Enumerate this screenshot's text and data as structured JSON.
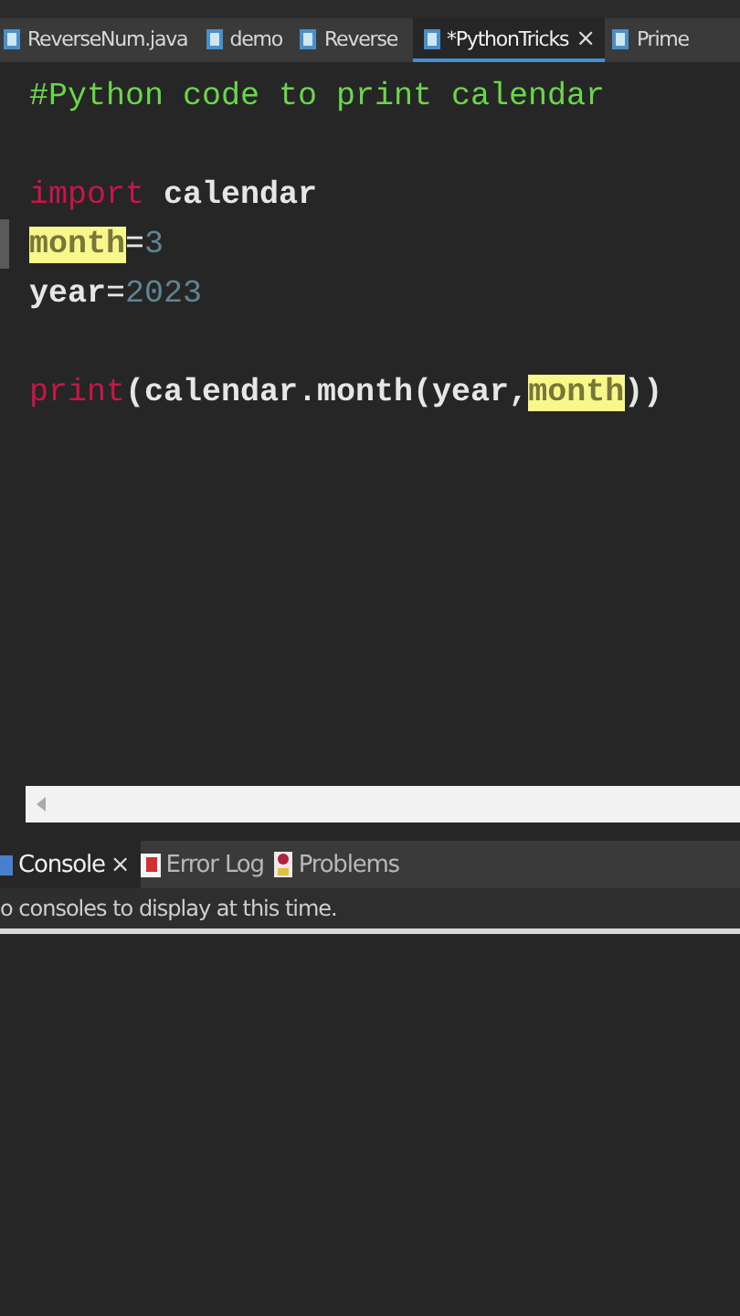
{
  "editor_tabs": [
    {
      "label": "ReverseNum.java",
      "selected": false
    },
    {
      "label": "demo",
      "selected": false
    },
    {
      "label": "Reverse",
      "selected": false
    },
    {
      "label": "*PythonTricks",
      "selected": true,
      "close": "×"
    },
    {
      "label": "Prime",
      "selected": false
    }
  ],
  "code_lines": [
    {
      "current": false,
      "tokens": [
        {
          "kind": "comment",
          "text": "#Python code to print calendar"
        }
      ]
    },
    {
      "current": false
    },
    {
      "current": false,
      "tokens": [
        {
          "kind": "keyword",
          "text": "import"
        },
        {
          "kind": "plain",
          "text": " calendar"
        }
      ]
    },
    {
      "current": true,
      "tokens": [
        {
          "kind": "plain",
          "text": "month",
          "highlighted": true
        },
        {
          "kind": "op",
          "text": "="
        },
        {
          "kind": "number",
          "text": "3"
        }
      ]
    },
    {
      "current": false,
      "tokens": [
        {
          "kind": "plain",
          "text": "year"
        },
        {
          "kind": "op",
          "text": "="
        },
        {
          "kind": "number",
          "text": "2023"
        }
      ]
    },
    {
      "current": false
    },
    {
      "current": false,
      "tokens": [
        {
          "kind": "keyword",
          "text": "print"
        },
        {
          "kind": "plain",
          "text": "(calendar.month(year,"
        },
        {
          "kind": "plain",
          "text": "month",
          "highlighted": true
        },
        {
          "kind": "plain",
          "text": "))"
        }
      ]
    }
  ],
  "panel_tabs": [
    {
      "label": "Console",
      "selected": true,
      "close": "×",
      "kind": "console"
    },
    {
      "label": "Error Log",
      "selected": false,
      "kind": "log"
    },
    {
      "label": "Problems",
      "selected": false,
      "kind": "problems"
    }
  ],
  "console_message": "o consoles to display at this time."
}
